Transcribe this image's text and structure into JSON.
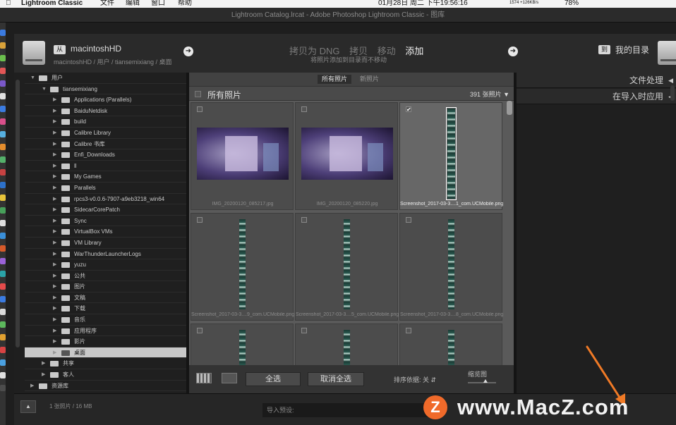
{
  "menubar": {
    "app": "Lightroom Classic",
    "items": [
      "文件",
      "编辑",
      "窗口",
      "帮助"
    ],
    "net": "1574 +126KB/s",
    "clock": "01月28日 周二 下午19:56:16",
    "battery": "78%"
  },
  "window_title": "Lightroom Catalog.lrcat - Adobe Photoshop Lightroom Classic - 图库",
  "header": {
    "from_badge": "从",
    "from_name": "macintoshHD",
    "from_path": "macintoshHD / 用户 / tiansemixiang / 桌面",
    "modes": [
      "拷贝为 DNG",
      "拷贝",
      "移动",
      "添加"
    ],
    "active_mode": "添加",
    "mode_desc": "将照片添加到目录而不移动",
    "to_badge": "到",
    "to_name": "我的目录"
  },
  "tree": [
    {
      "label": "用户",
      "level": 0,
      "expanded": true
    },
    {
      "label": "tiansemixiang",
      "level": 1,
      "expanded": true
    },
    {
      "label": "Applications (Parallels)",
      "level": 2
    },
    {
      "label": "BaiduNetdisk",
      "level": 2
    },
    {
      "label": "build",
      "level": 2
    },
    {
      "label": "Calibre Library",
      "level": 2
    },
    {
      "label": "Calibre 书库",
      "level": 2
    },
    {
      "label": "Enfi_Downloads",
      "level": 2
    },
    {
      "label": "ll",
      "level": 2
    },
    {
      "label": "My Games",
      "level": 2
    },
    {
      "label": "Parallels",
      "level": 2
    },
    {
      "label": "rpcs3-v0.0.6-7907-a9eb3218_win64",
      "level": 2
    },
    {
      "label": "SidecarCorePatch",
      "level": 2
    },
    {
      "label": "Sync",
      "level": 2
    },
    {
      "label": "VirtualBox VMs",
      "level": 2
    },
    {
      "label": "VM Library",
      "level": 2
    },
    {
      "label": "WarThunderLauncherLogs",
      "level": 2
    },
    {
      "label": "yuzu",
      "level": 2
    },
    {
      "label": "公共",
      "level": 2
    },
    {
      "label": "图片",
      "level": 2
    },
    {
      "label": "文稿",
      "level": 2
    },
    {
      "label": "下载",
      "level": 2
    },
    {
      "label": "音乐",
      "level": 2
    },
    {
      "label": "应用程序",
      "level": 2
    },
    {
      "label": "影片",
      "level": 2
    },
    {
      "label": "桌面",
      "level": 2,
      "selected": true
    },
    {
      "label": "共享",
      "level": 1
    },
    {
      "label": "客人",
      "level": 1
    },
    {
      "label": "资源库",
      "level": 0
    }
  ],
  "filter_tabs": [
    "所有照片",
    "新照片"
  ],
  "grid": {
    "title": "所有照片",
    "count": "391 张照片",
    "cells": [
      {
        "name": "IMG_20200120_085217.jpg",
        "kind": "photo",
        "checked": false
      },
      {
        "name": "IMG_20200120_085220.jpg",
        "kind": "photo",
        "checked": false
      },
      {
        "name": "Screenshot_2017-03-3....1_com.UCMobile.png",
        "kind": "strip",
        "checked": true,
        "selected": true
      },
      {
        "name": "Screenshot_2017-03-3....9_com.UCMobile.png",
        "kind": "strip",
        "checked": false
      },
      {
        "name": "Screenshot_2017-03-3....5_com.UCMobile.png",
        "kind": "strip",
        "checked": false
      },
      {
        "name": "Screenshot_2017-03-3....8_com.UCMobile.png",
        "kind": "strip",
        "checked": false
      },
      {
        "name": "",
        "kind": "strip",
        "checked": false
      },
      {
        "name": "",
        "kind": "strip",
        "checked": false
      },
      {
        "name": "",
        "kind": "strip",
        "checked": false
      }
    ]
  },
  "toolbar": {
    "select_all": "全选",
    "deselect_all": "取消全选",
    "sort_label": "排序依据:",
    "sort_value": "关",
    "thumb_label": "缩览图"
  },
  "right_panel": {
    "sections": [
      "文件处理",
      "在导入时应用"
    ]
  },
  "bottom": {
    "status": "1 张照片 / 16 MB",
    "preset_label": "导入预设:"
  },
  "watermark": {
    "logo_letter": "Z",
    "text": "www.MacZ.com"
  },
  "colors": {
    "accent_arrow": "#f07a26",
    "panel_bg": "#1f1f1f",
    "grid_bg": "#5a5a5a"
  }
}
